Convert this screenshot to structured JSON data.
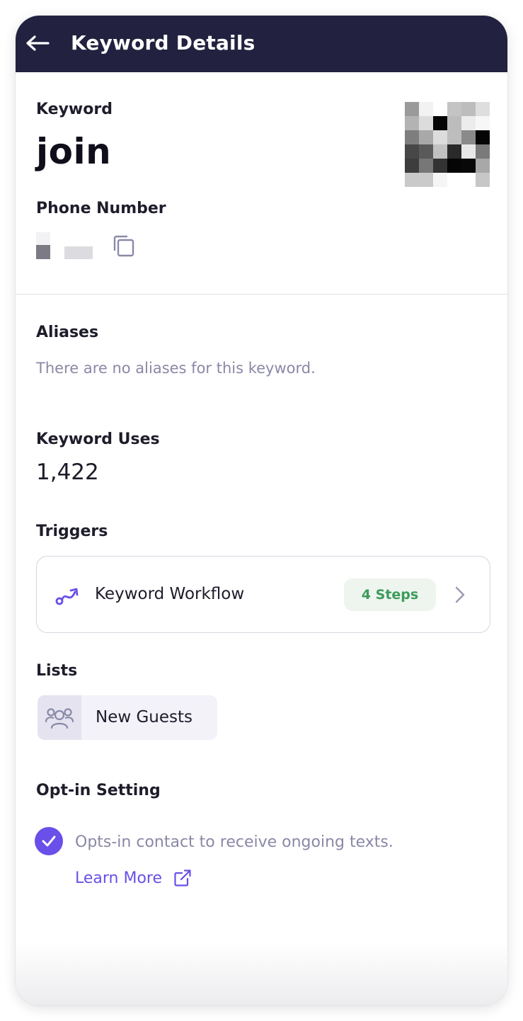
{
  "header": {
    "title": "Keyword Details",
    "back_icon": "arrow-left-icon",
    "background": "#22213f"
  },
  "keyword": {
    "label": "Keyword",
    "value": "join"
  },
  "phone": {
    "label": "Phone Number",
    "copy_icon": "copy-icon"
  },
  "aliases": {
    "label": "Aliases",
    "empty_text": "There are no aliases for this keyword."
  },
  "uses": {
    "label": "Keyword Uses",
    "value": "1,422"
  },
  "triggers": {
    "label": "Triggers",
    "items": [
      {
        "title": "Keyword Workflow",
        "badge": "4 Steps",
        "icon": "workflow-icon",
        "chevron": "chevron-right-icon"
      }
    ]
  },
  "lists": {
    "label": "Lists",
    "items": [
      {
        "name": "New Guests",
        "icon": "group-icon"
      }
    ]
  },
  "optin": {
    "label": "Opt-in Setting",
    "text": "Opts-in contact to receive ongoing texts.",
    "checked": true,
    "learn_more": "Learn More",
    "external_icon": "external-link-icon"
  },
  "colors": {
    "accent": "#6a4fe8",
    "success": "#3c9b5a",
    "muted": "#8a88a6"
  }
}
